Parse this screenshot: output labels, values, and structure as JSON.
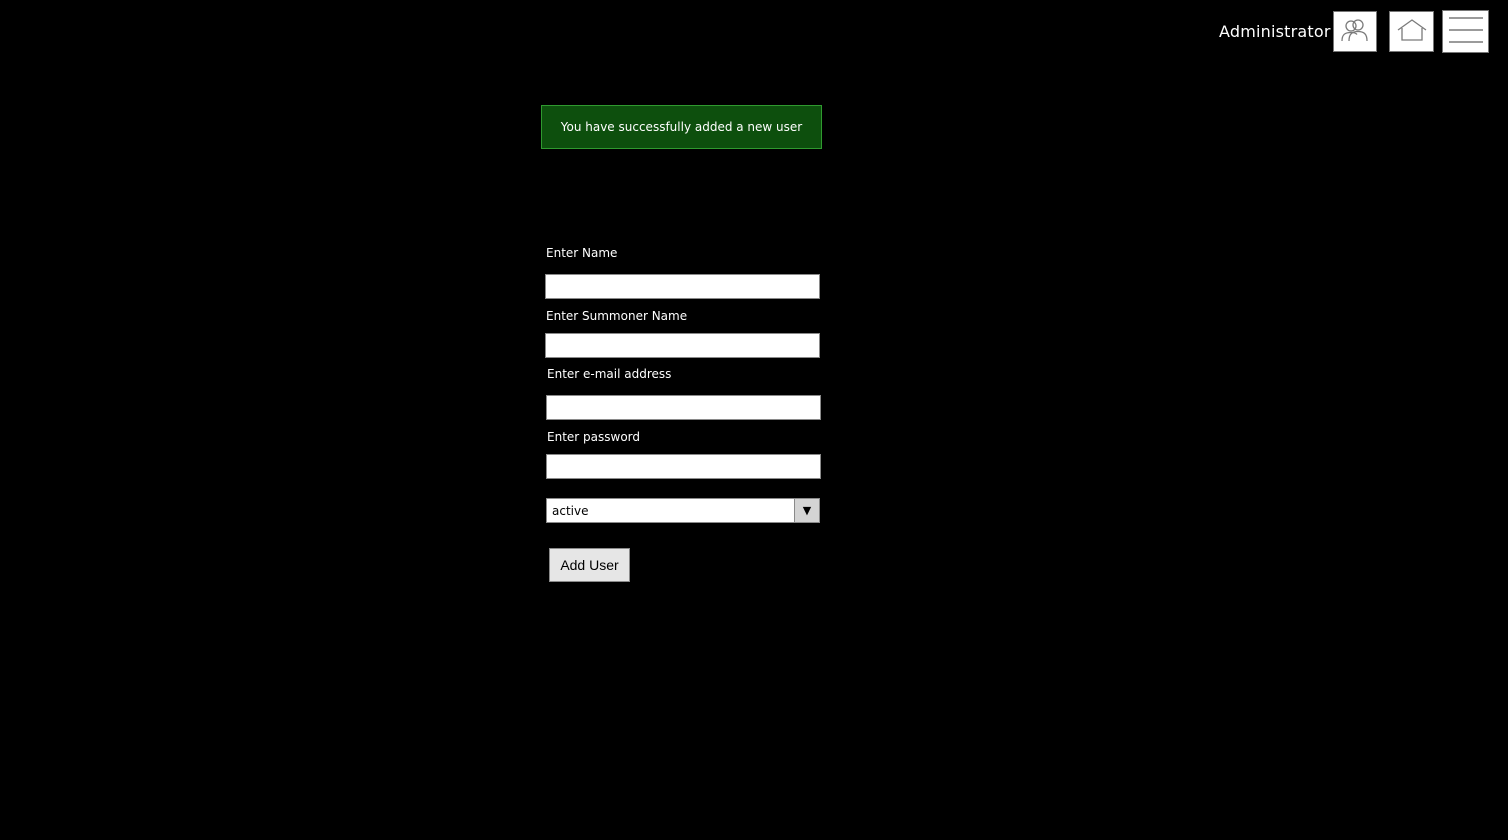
{
  "header": {
    "user_label": "Administrator",
    "icons": {
      "users": "users-icon",
      "home": "home-icon",
      "menu": "hamburger-menu-icon"
    }
  },
  "alert": {
    "message": "You have successfully added a new user",
    "colors": {
      "background": "#0d4f0d",
      "border": "#2f9a2f"
    }
  },
  "form": {
    "name_label": "Enter Name",
    "name_value": "",
    "summoner_label": "Enter Summoner Name",
    "summoner_value": "",
    "email_label": "Enter e-mail address",
    "email_value": "",
    "password_label": "Enter password",
    "password_value": "",
    "status_value": "active",
    "submit_label": "Add User"
  }
}
